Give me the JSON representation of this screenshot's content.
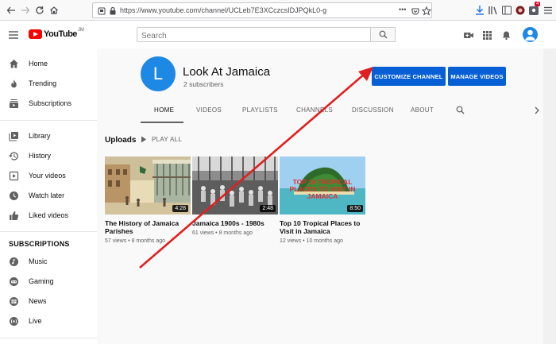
{
  "browser": {
    "url": "https://www.youtube.com/channel/UCLeb7E3XCczcsIDJPQkL0-g",
    "url_menu": "•••",
    "tab_badge": "4"
  },
  "header": {
    "logo_text": "YouTube",
    "logo_sup": "JM",
    "search_placeholder": "Search"
  },
  "sidebar": {
    "items": [
      {
        "label": "Home",
        "icon": "home-icon"
      },
      {
        "label": "Trending",
        "icon": "flame-icon"
      },
      {
        "label": "Subscriptions",
        "icon": "subscriptions-icon"
      },
      {
        "label": "Library",
        "icon": "library-icon"
      },
      {
        "label": "History",
        "icon": "history-icon"
      },
      {
        "label": "Your videos",
        "icon": "your-videos-icon"
      },
      {
        "label": "Watch later",
        "icon": "clock-icon"
      },
      {
        "label": "Liked videos",
        "icon": "thumbs-up-icon"
      }
    ],
    "subscriptions_heading": "SUBSCRIPTIONS",
    "subscriptions": [
      {
        "label": "Music",
        "icon": "music-icon"
      },
      {
        "label": "Gaming",
        "icon": "gaming-icon"
      },
      {
        "label": "News",
        "icon": "news-icon"
      },
      {
        "label": "Live",
        "icon": "live-icon"
      }
    ]
  },
  "channel": {
    "avatar_letter": "L",
    "name": "Look At Jamaica",
    "subscribers": "2 subscribers",
    "customize_label": "CUSTOMIZE CHANNEL",
    "manage_label": "MANAGE VIDEOS",
    "tabs": [
      "HOME",
      "VIDEOS",
      "PLAYLISTS",
      "CHANNELS",
      "DISCUSSION",
      "ABOUT"
    ]
  },
  "uploads": {
    "title": "Uploads",
    "play_all": "PLAY ALL",
    "videos": [
      {
        "title": "The History of Jamaica Parishes",
        "meta": "57 views • 8 months ago",
        "duration": "4:28"
      },
      {
        "title": "Jamaica 1900s - 1980s",
        "meta": "61 views • 8 months ago",
        "duration": "2:48"
      },
      {
        "title": "Top 10 Tropical Places to Visit in Jamaica",
        "meta": "12 views • 10 months ago",
        "duration": "8:50",
        "thumb_text": "TOP 10 TROPICAL PLACES TO VISIT IN JAMAICA"
      }
    ]
  },
  "colors": {
    "accent_blue": "#065fd4",
    "avatar_blue": "#1e88e5",
    "logo_red": "#ff0000",
    "annotation_red": "#e02020"
  }
}
